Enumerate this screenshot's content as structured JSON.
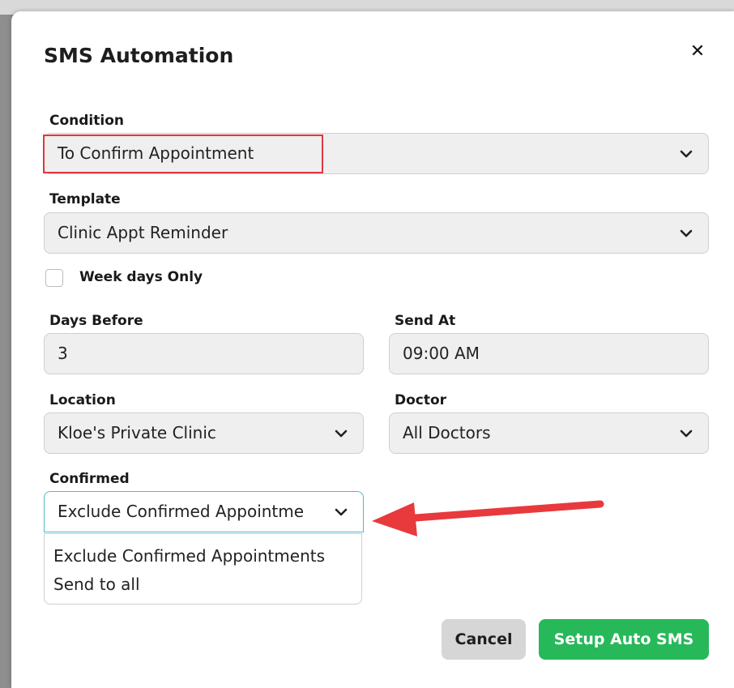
{
  "background": {
    "header_fragments": [
      "Days Before",
      "Send At",
      "Location"
    ]
  },
  "modal": {
    "title": "SMS Automation",
    "close_icon": "close-icon"
  },
  "form": {
    "condition": {
      "label": "Condition",
      "value": "To Confirm Appointment"
    },
    "template": {
      "label": "Template",
      "value": "Clinic Appt Reminder"
    },
    "weekdays_only": {
      "label": "Week days Only",
      "checked": false
    },
    "days_before": {
      "label": "Days Before",
      "value": "3"
    },
    "send_at": {
      "label": "Send At",
      "value": "09:00 AM"
    },
    "location": {
      "label": "Location",
      "value": "Kloe's Private Clinic"
    },
    "doctor": {
      "label": "Doctor",
      "value": "All Doctors"
    },
    "confirmed": {
      "label": "Confirmed",
      "value": "Exclude Confirmed Appointme",
      "options": [
        "Exclude Confirmed Appointments",
        "Send to all"
      ]
    }
  },
  "buttons": {
    "cancel": "Cancel",
    "setup": "Setup Auto SMS"
  },
  "colors": {
    "highlight_border": "#e0383d",
    "arrow": "#e8393d",
    "primary_button": "#27b85a",
    "focus_border": "#55b8c9"
  }
}
